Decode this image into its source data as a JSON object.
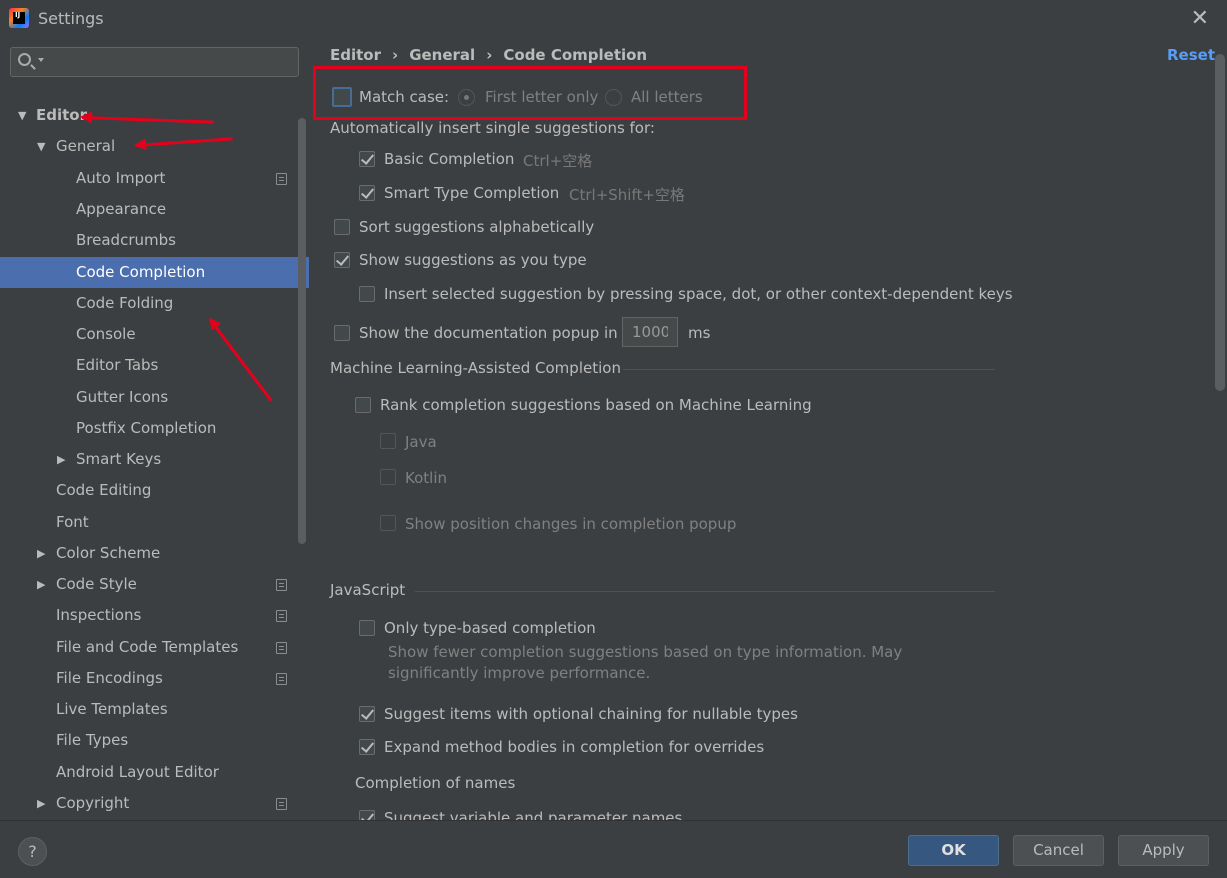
{
  "window": {
    "title": "Settings",
    "app_icon": "intellij-idea-icon",
    "close_icon": "close-icon",
    "close_glyph": "✕"
  },
  "sidebar": {
    "search": {
      "value": "",
      "placeholder": ""
    },
    "items": [
      {
        "label": "Editor",
        "expanded": true,
        "bold": true
      },
      {
        "label": "General",
        "expanded": true
      },
      {
        "label": "Auto Import",
        "project_icon": true
      },
      {
        "label": "Appearance"
      },
      {
        "label": "Breadcrumbs"
      },
      {
        "label": "Code Completion",
        "selected": true
      },
      {
        "label": "Code Folding"
      },
      {
        "label": "Console"
      },
      {
        "label": "Editor Tabs"
      },
      {
        "label": "Gutter Icons"
      },
      {
        "label": "Postfix Completion"
      },
      {
        "label": "Smart Keys",
        "expanded": false
      },
      {
        "label": "Code Editing"
      },
      {
        "label": "Font"
      },
      {
        "label": "Color Scheme",
        "expanded": false
      },
      {
        "label": "Code Style",
        "expanded": false,
        "project_icon": true
      },
      {
        "label": "Inspections",
        "project_icon": true
      },
      {
        "label": "File and Code Templates",
        "project_icon": true
      },
      {
        "label": "File Encodings",
        "project_icon": true
      },
      {
        "label": "Live Templates"
      },
      {
        "label": "File Types"
      },
      {
        "label": "Android Layout Editor"
      },
      {
        "label": "Copyright",
        "expanded": false,
        "project_icon": true
      }
    ]
  },
  "breadcrumb": {
    "items": [
      "Editor",
      "General",
      "Code Completion"
    ],
    "separator": "›"
  },
  "reset_label": "Reset",
  "content": {
    "match_case": {
      "label": "Match case:",
      "checked": false,
      "options": [
        "First letter only",
        "All letters"
      ],
      "selected": "First letter only"
    },
    "auto_insert_heading": "Automatically insert single suggestions for:",
    "basic_completion": {
      "label": "Basic Completion",
      "shortcut": "Ctrl+空格",
      "checked": true
    },
    "smart_type_completion": {
      "label": "Smart Type Completion",
      "shortcut": "Ctrl+Shift+空格",
      "checked": true
    },
    "sort_alpha": {
      "label": "Sort suggestions alphabetically",
      "checked": false
    },
    "show_as_you_type": {
      "label": "Show suggestions as you type",
      "checked": true
    },
    "insert_selected": {
      "label": "Insert selected suggestion by pressing space, dot, or other context-dependent keys",
      "checked": false
    },
    "doc_popup": {
      "label": "Show the documentation popup in",
      "value": "1000",
      "unit": "ms",
      "checked": false
    },
    "ml_section": "Machine Learning-Assisted Completion",
    "ml_rank": {
      "label": "Rank completion suggestions based on Machine Learning",
      "checked": false
    },
    "ml_java": "Java",
    "ml_kotlin": "Kotlin",
    "ml_positions": "Show position changes in completion popup",
    "js_section": "JavaScript",
    "js_type_based": {
      "label": "Only type-based completion",
      "checked": false
    },
    "js_type_based_desc_line1": "Show fewer completion suggestions based on type information. May",
    "js_type_based_desc_line2": "significantly improve performance.",
    "js_optional_chaining": {
      "label": "Suggest items with optional chaining for nullable types",
      "checked": true
    },
    "js_expand_bodies": {
      "label": "Expand method bodies in completion for overrides",
      "checked": true
    },
    "names_heading": "Completion of names",
    "names_suggest": {
      "label": "Suggest variable and parameter names",
      "checked": true
    }
  },
  "footer": {
    "help": "?",
    "ok": "OK",
    "cancel": "Cancel",
    "apply": "Apply"
  },
  "colors": {
    "accent": "#4b6eaf",
    "link": "#589df6",
    "annotation": "#e5001b",
    "ok_button": "#365880"
  }
}
